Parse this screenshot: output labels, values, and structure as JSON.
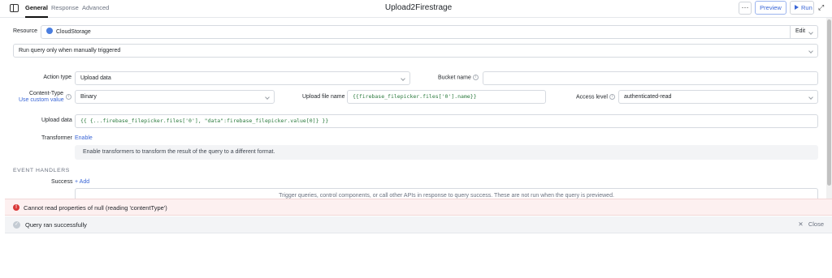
{
  "header": {
    "tabs": [
      {
        "label": "General",
        "active": true
      },
      {
        "label": "Response",
        "active": false
      },
      {
        "label": "Advanced",
        "active": false
      }
    ],
    "title": "Upload2Firestrage",
    "more_label": "···",
    "preview_label": "Preview",
    "run_label": "Run"
  },
  "resource": {
    "label": "Resource",
    "value": "CloudStorage",
    "edit_label": "Edit"
  },
  "trigger": {
    "value": "Run query only when manually triggered"
  },
  "action_type": {
    "label": "Action type",
    "value": "Upload data"
  },
  "bucket_name": {
    "label": "Bucket name",
    "value": ""
  },
  "content_type": {
    "label": "Content-Type",
    "custom_link": "Use custom value",
    "value": "Binary"
  },
  "upload_file_name": {
    "label": "Upload file name",
    "value": "{{firebase_filepicker.files['0'].name}}"
  },
  "access_level": {
    "label": "Access level",
    "value": "authenticated-read"
  },
  "upload_data": {
    "label": "Upload data",
    "value": "{{ {...firebase_filepicker.files['0'], \"data\":firebase_filepicker.value[0]} }}"
  },
  "transformer": {
    "label": "Transformer",
    "enable_link": "Enable",
    "description": "Enable transformers to transform the result of the query to a different format."
  },
  "event_handlers": {
    "heading": "EVENT HANDLERS",
    "success_label": "Success",
    "add_label": "+ Add",
    "empty_hint": "Trigger queries, control components, or call other APIs in response to query success. These are not run when the query is previewed."
  },
  "error_bar": {
    "message": "Cannot read properties of null (reading 'contentType')"
  },
  "status_bar": {
    "message": "Query ran successfully",
    "close_label": "Close"
  },
  "colors": {
    "accent": "#3a66d6",
    "error": "#d93838",
    "error_bg": "#fdf0f0"
  }
}
